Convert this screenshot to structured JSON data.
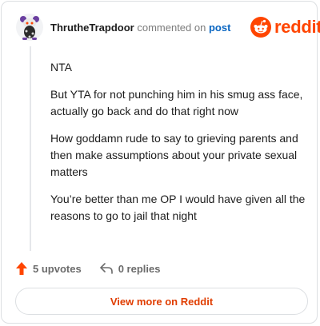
{
  "comment": {
    "username": "ThrutheTrapdoor",
    "action_text": "commented on",
    "post_link_text": "post",
    "paragraphs": [
      "NTA",
      "But YTA for not punching him in his smug ass face, actually go back and do that right now",
      "How goddamn rude to say to grieving parents and then make assumptions about your private sexual matters",
      "You’re better than me OP I would have given all the reasons to go to jail that night"
    ]
  },
  "brand": {
    "wordmark": "reddit",
    "icon": "reddit-alien-icon",
    "color": "#ff4500"
  },
  "actions": {
    "upvotes_label": "5 upvotes",
    "upvote_icon": "upvote-arrow-icon",
    "upvote_color": "#ff4500",
    "replies_label": "0 replies",
    "reply_icon": "reply-arrow-icon"
  },
  "footer": {
    "view_more_label": "View more on Reddit"
  }
}
